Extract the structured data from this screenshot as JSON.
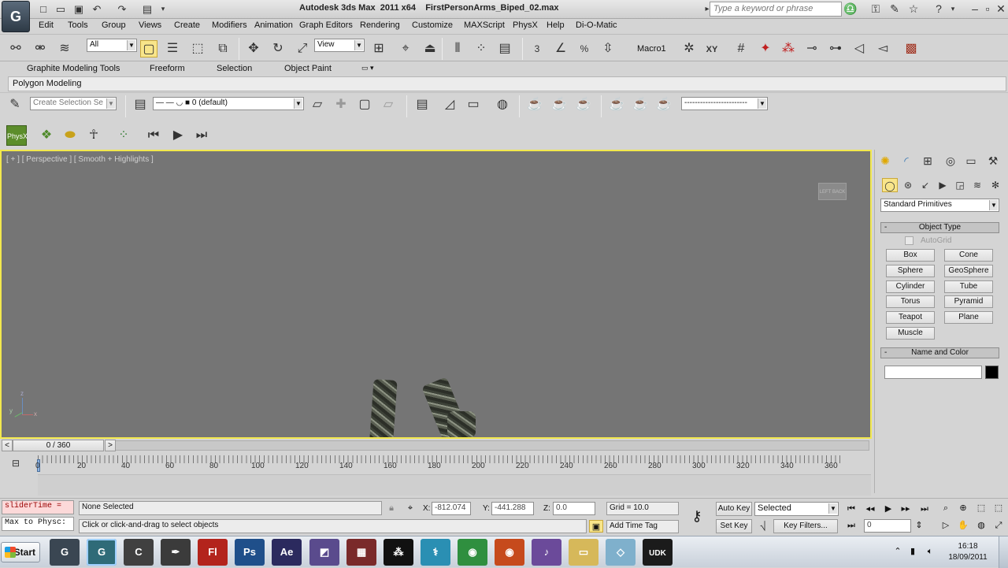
{
  "window": {
    "title": "Autodesk 3ds Max  2011 x64    FirstPersonArms_Biped_02.max",
    "search_placeholder": "Type a keyword or phrase",
    "app_logo_glyph": "G"
  },
  "menu": [
    "Edit",
    "Tools",
    "Group",
    "Views",
    "Create",
    "Modifiers",
    "Animation",
    "Graph Editors",
    "Rendering",
    "Customize",
    "MAXScript",
    "PhysX",
    "Help",
    "Di-O-Matic"
  ],
  "main_toolbar": {
    "selection_filter": "All",
    "reference_coord": "View",
    "macro_label": "Macro1",
    "snap_labels": [
      "3",
      "%",
      "XY"
    ]
  },
  "ribbon": {
    "tabs": [
      "Graphite Modeling Tools",
      "Freeform",
      "Selection",
      "Object Paint"
    ],
    "panel_label": "Polygon Modeling"
  },
  "toolbar2": {
    "selection_set_placeholder": "Create Selection Se",
    "layer_value": "0 (default)",
    "named_dropdown_value": "------------------------"
  },
  "viewport": {
    "label": "[ + ] [ Perspective ] [ Smooth + Highlights ]",
    "viewcube_labels": [
      "LEFT",
      "BACK"
    ],
    "axis_labels": [
      "z",
      "x",
      "y"
    ]
  },
  "command_panel": {
    "category_dropdown": "Standard Primitives",
    "object_type_title": "Object Type",
    "autogrid_label": "AutoGrid",
    "autogrid_checked": false,
    "primitives": [
      "Box",
      "Cone",
      "Sphere",
      "GeoSphere",
      "Cylinder",
      "Tube",
      "Torus",
      "Pyramid",
      "Teapot",
      "Plane",
      "Muscle"
    ],
    "name_color_title": "Name and Color",
    "name_value": "",
    "object_color": "#000000"
  },
  "time_slider": {
    "frame_readout": "0 / 360",
    "prev": "<",
    "next": ">"
  },
  "track_bar": {
    "tick_labels": [
      "0",
      "20",
      "40",
      "60",
      "80",
      "100",
      "120",
      "140",
      "160",
      "180",
      "200",
      "220",
      "240",
      "260",
      "280",
      "300",
      "320",
      "340",
      "360"
    ]
  },
  "status": {
    "maxscript_line1": "sliderTime =",
    "maxscript_line2": "Max to Physc:",
    "selection_status": "None Selected",
    "prompt": "Click or click-and-drag to select objects",
    "x_label": "X:",
    "x_value": "-812.074",
    "y_label": "Y:",
    "y_value": "-441.288",
    "z_label": "Z:",
    "z_value": "0.0",
    "grid": "Grid = 10.0",
    "add_time_tag": "Add Time Tag",
    "auto_key": "Auto Key",
    "set_key": "Set Key",
    "key_mode": "Selected",
    "key_filters": "Key Filters...",
    "current_frame": "0"
  },
  "taskbar": {
    "start": "Start",
    "apps": [
      {
        "name": "3ds Max",
        "glyph": "G",
        "color": "#3a4652"
      },
      {
        "name": "3ds Max active",
        "glyph": "G",
        "color": "#2f6b78"
      },
      {
        "name": "Cinema",
        "glyph": "C",
        "color": "#404040"
      },
      {
        "name": "Pen",
        "glyph": "✒",
        "color": "#3b3b3b"
      },
      {
        "name": "Flash",
        "glyph": "Fl",
        "color": "#b3241c"
      },
      {
        "name": "Photoshop",
        "glyph": "Ps",
        "color": "#1f4f8a"
      },
      {
        "name": "After Effects",
        "glyph": "Ae",
        "color": "#2b2a5e"
      },
      {
        "name": "Media Encoder",
        "glyph": "◩",
        "color": "#5a4b8d"
      },
      {
        "name": "Hex",
        "glyph": "▦",
        "color": "#7a2a2a"
      },
      {
        "name": "BlackBerry",
        "glyph": "⁂",
        "color": "#111111"
      },
      {
        "name": "Body",
        "glyph": "⚕",
        "color": "#2a8fb3"
      },
      {
        "name": "Chrome",
        "glyph": "◉",
        "color": "#2f8f3f"
      },
      {
        "name": "Chrome Canary",
        "glyph": "◉",
        "color": "#c64a1c"
      },
      {
        "name": "Audio",
        "glyph": "♪",
        "color": "#6b4a9a"
      },
      {
        "name": "Folder",
        "glyph": "▭",
        "color": "#d6b85a"
      },
      {
        "name": "Paper",
        "glyph": "◇",
        "color": "#7fb0cc"
      },
      {
        "name": "UDK",
        "glyph": "UDK",
        "color": "#1b1b1b"
      }
    ],
    "time": "16:18",
    "date": "18/09/2011"
  }
}
